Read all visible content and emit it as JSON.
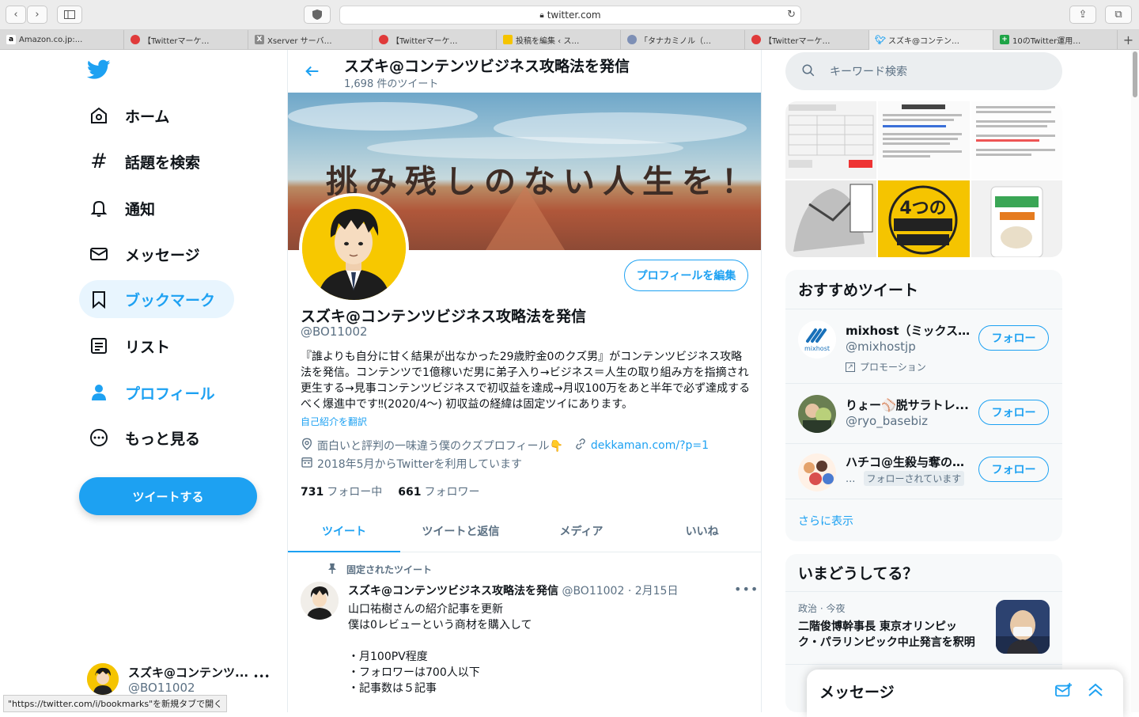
{
  "browser": {
    "url": "twitter.com",
    "tabs": [
      {
        "label": "Amazon.co.jp:...",
        "icon": "amazon-icon",
        "color": "#ffffff"
      },
      {
        "label": "【Twitterマーケ…",
        "icon": "red-logo-icon",
        "color": "#e03a3a"
      },
      {
        "label": "Xserver サーバ…",
        "icon": "xserver-icon",
        "color": "#8a8a8a"
      },
      {
        "label": "【Twitterマーケ…",
        "icon": "red-logo-icon",
        "color": "#e03a3a"
      },
      {
        "label": "投稿を編集 ‹ ス…",
        "icon": "avatar-icon",
        "color": "#f5c400"
      },
      {
        "label": "「タナカミノル（…",
        "icon": "blob-icon",
        "color": "#7d8fb5"
      },
      {
        "label": "【Twitterマーケ…",
        "icon": "red-logo-icon",
        "color": "#e03a3a"
      },
      {
        "label": "スズキ@コンテン…",
        "icon": "twitter-icon",
        "color": "#1da1f2",
        "active": true
      },
      {
        "label": "10のTwitter運用…",
        "icon": "green-plus-icon",
        "color": "#1ea447"
      }
    ],
    "status_url": "\"https://twitter.com/i/bookmarks\"を新規タブで開く"
  },
  "nav": {
    "items": [
      {
        "label": "ホーム"
      },
      {
        "label": "話題を検索"
      },
      {
        "label": "通知"
      },
      {
        "label": "メッセージ"
      },
      {
        "label": "ブックマーク"
      },
      {
        "label": "リスト"
      },
      {
        "label": "プロフィール"
      },
      {
        "label": "もっと見る"
      }
    ],
    "tweet_button": "ツイートする",
    "account": {
      "name": "スズキ@コンテンツ...",
      "handle": "@BO11002",
      "more": "•••"
    }
  },
  "main": {
    "title": "スズキ@コンテンツビジネス攻略法を発信",
    "tweet_count": "1,698 件のツイート",
    "banner_text": "挑み残しのない人生を！",
    "edit_button": "プロフィールを編集",
    "profile_name": "スズキ@コンテンツビジネス攻略法を発信",
    "profile_handle": "@BO11002",
    "bio": "『誰よりも自分に甘く結果が出なかった29歳貯金0のクズ男』がコンテンツビジネス攻略法を発信。コンテンツで1億稼いだ男に弟子入り→ビジネス＝人生の取り組み方を指摘され更生する→見事コンテンツビジネスで初収益を達成→月収100万をあと半年で必ず達成するべく爆進中です‼(2020/4〜) 初収益の経緯は固定ツイにあります。",
    "translate": "自己紹介を翻訳",
    "location": "面白いと評判の一味違う僕のクズプロフィール👇",
    "link": "dekkaman.com/?p=1",
    "joined": "2018年5月からTwitterを利用しています",
    "following_count": "731",
    "following_label": "フォロー中",
    "followers_count": "661",
    "followers_label": "フォロワー",
    "tabs": [
      "ツイート",
      "ツイートと返信",
      "メディア",
      "いいね"
    ],
    "pinned_label": "固定されたツイート",
    "tweet": {
      "name": "スズキ@コンテンツビジネス攻略法を発信",
      "handle_date": "@BO11002 · 2月15日",
      "more": "•••",
      "body": "山口祐樹さんの紹介記事を更新\n僕は0レビューという商材を購入して\n\n・月100PV程度\n・フォロワーは700人以下\n・記事数は５記事"
    }
  },
  "right": {
    "search_placeholder": "キーワード検索",
    "recommend": {
      "title": "おすすめツイート",
      "users": [
        {
          "name": "mixhost（ミックスホ...",
          "handle": "@mixhostjp",
          "sub": "プロモーション",
          "button": "フォロー"
        },
        {
          "name": "りょー⚾脱サラトレ...",
          "handle": "@ryo_basebiz",
          "button": "フォロー"
        },
        {
          "name": "ハチコ@生殺与奪の権...",
          "handle": "...",
          "sub": "フォローされています",
          "button": "フォロー"
        }
      ],
      "more": "さらに表示"
    },
    "trends": {
      "title": "いまどうしてる？",
      "items": [
        {
          "meta": "政治 · 今夜",
          "title": "二階俊博幹事長 東京オリンピック・パラリンピック中止発言を釈明"
        }
      ]
    },
    "messages": {
      "title": "メッセージ"
    }
  },
  "colors": {
    "accent": "#1da1f2",
    "text": "#0f1419",
    "muted": "#5b7083"
  }
}
